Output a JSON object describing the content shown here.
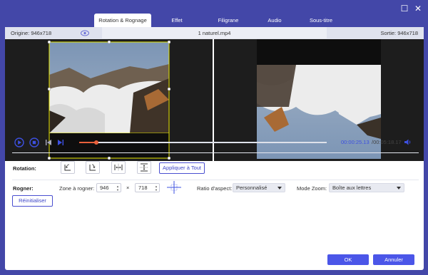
{
  "tabs": [
    {
      "label": "Rotation & Rognage",
      "active": true
    },
    {
      "label": "Effet",
      "active": false
    },
    {
      "label": "Filigrane",
      "active": false
    },
    {
      "label": "Audio",
      "active": false
    },
    {
      "label": "Sous-titre",
      "active": false
    }
  ],
  "info": {
    "origin": "Origine: 946x718",
    "filename": "1 naturel.mp4",
    "output": "Sortie: 946x718"
  },
  "playback": {
    "current": "00:00:25.13",
    "total": "/00:05:18.17",
    "progress": 0.07
  },
  "rotation": {
    "label": "Rotation:",
    "apply_all": "Appliquer à Tout"
  },
  "crop": {
    "label": "Rogner:",
    "zone_label": "Zone à rogner:",
    "width": "946",
    "times": "×",
    "height": "718",
    "aspect_label": "Ratio d'aspect:",
    "aspect_value": "Personnalisé",
    "zoom_label": "Mode Zoom:",
    "zoom_value": "Boîte aux lettres",
    "reset": "Réinitialiser"
  },
  "buttons": {
    "ok": "OK",
    "cancel": "Annuler"
  },
  "colors": {
    "accent": "#4b56e8",
    "titlebar": "#4347a8",
    "progress": "#e8603c",
    "crop_frame": "#e6e600"
  }
}
